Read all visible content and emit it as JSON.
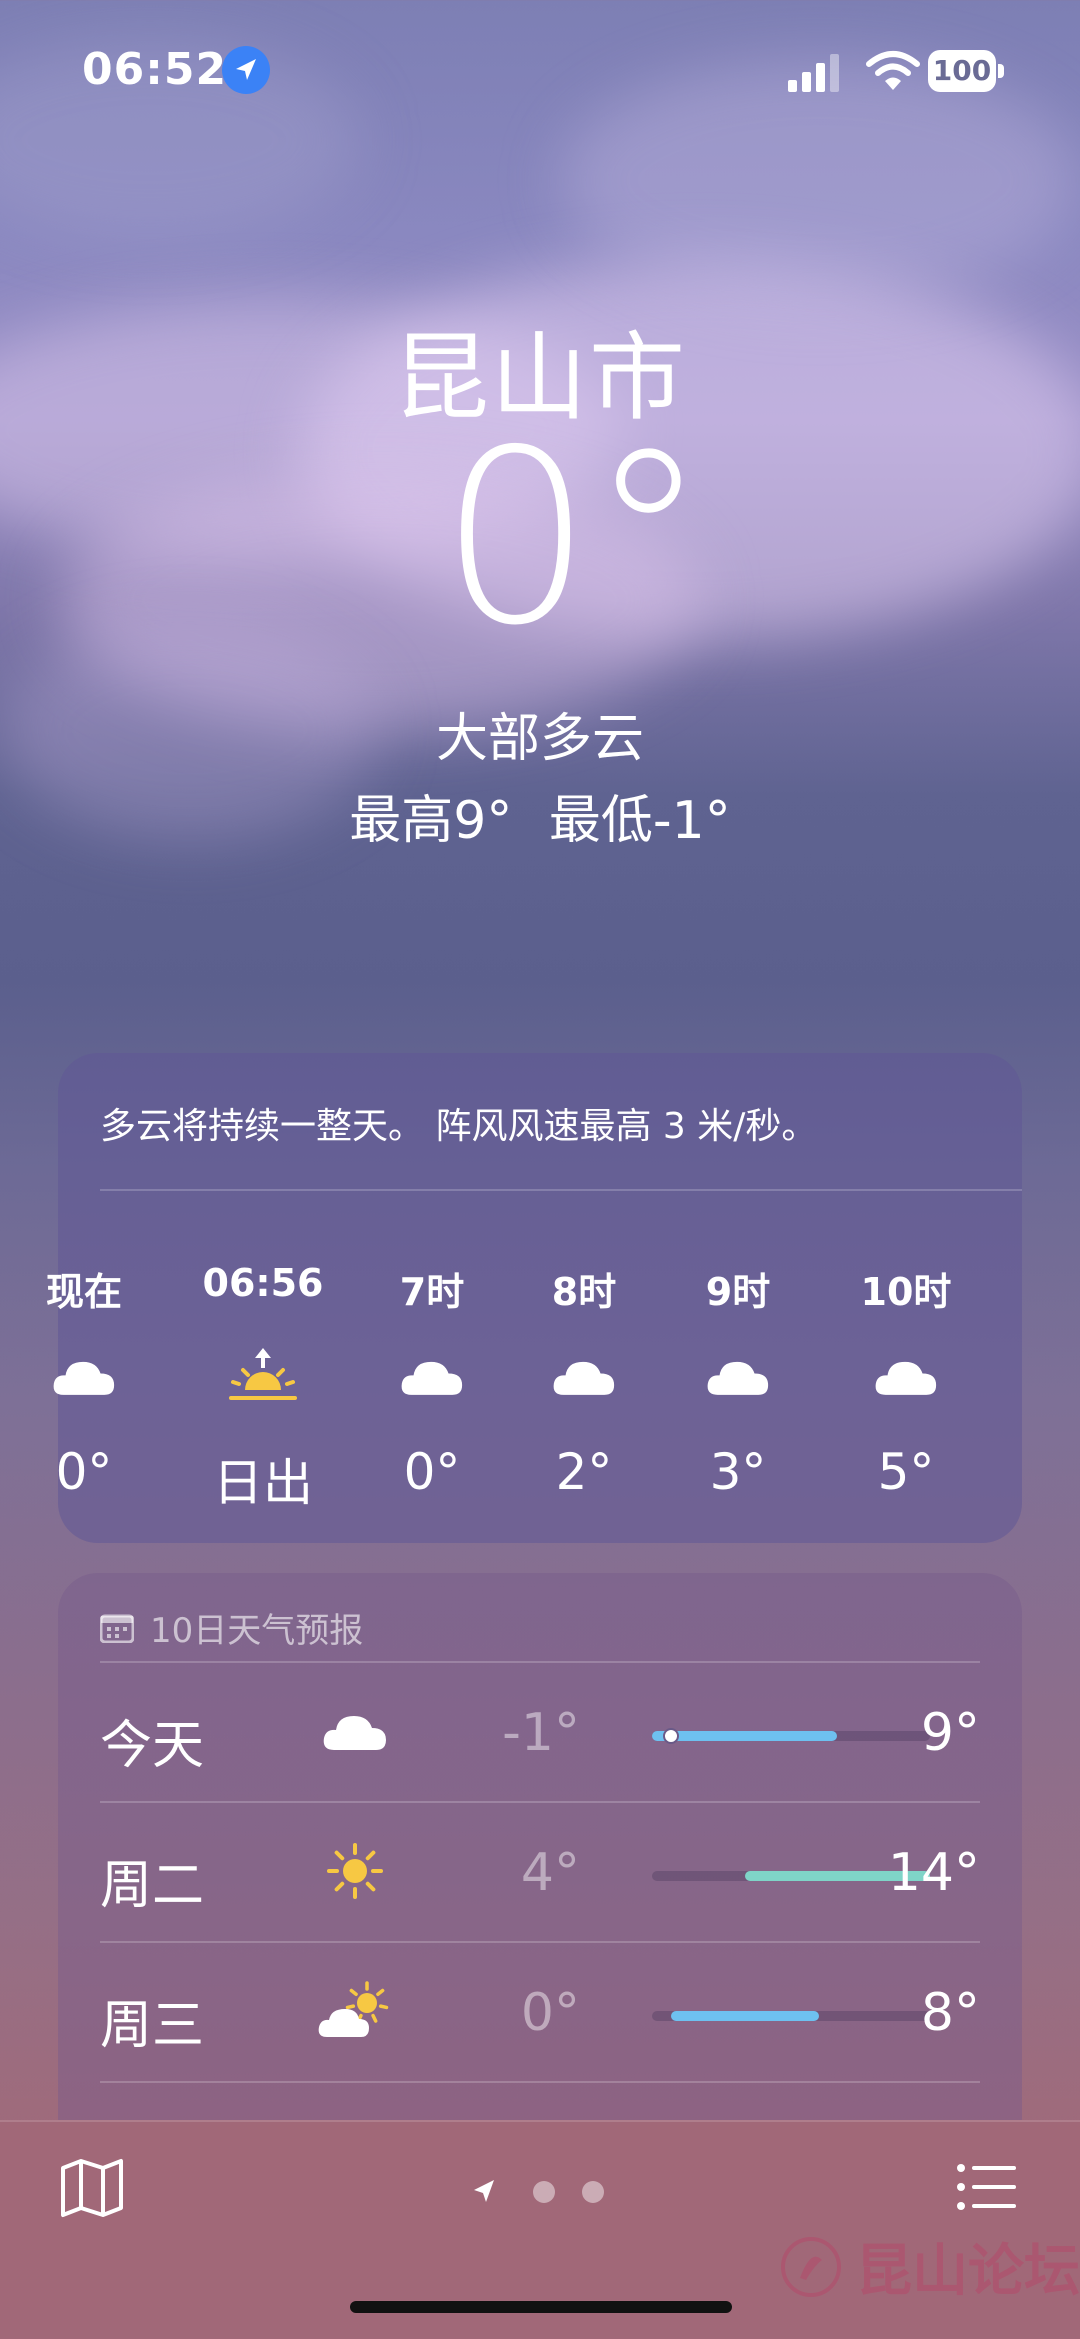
{
  "status": {
    "time": "06:52",
    "battery": "100"
  },
  "header": {
    "city": "昆山市",
    "temp": "0°",
    "condition": "大部多云",
    "high": "最高9°",
    "low": "最低-1°"
  },
  "hourly": {
    "summary": "多云将持续一整天。 阵风风速最高 3 米/秒。",
    "items": [
      {
        "label": "现在",
        "icon": "cloud-icon",
        "value": "0°"
      },
      {
        "label": "06:56",
        "icon": "sunrise-icon",
        "value": "日出"
      },
      {
        "label": "7时",
        "icon": "cloud-icon",
        "value": "0°"
      },
      {
        "label": "8时",
        "icon": "cloud-icon",
        "value": "2°"
      },
      {
        "label": "9时",
        "icon": "cloud-icon",
        "value": "3°"
      },
      {
        "label": "10时",
        "icon": "cloud-icon",
        "value": "5°"
      }
    ]
  },
  "daily": {
    "title": "10日天气预报",
    "range": {
      "min": -1,
      "max": 14
    },
    "days": [
      {
        "day": "今天",
        "icon": "cloud-icon",
        "low": "-1°",
        "high": "9°",
        "low_val": -1,
        "high_val": 9,
        "current": 0,
        "color": "#6ec1f0"
      },
      {
        "day": "周二",
        "icon": "sun-icon",
        "low": "4°",
        "high": "14°",
        "low_val": 4,
        "high_val": 14,
        "color": "#7fd4c8"
      },
      {
        "day": "周三",
        "icon": "partly-sunny-icon",
        "low": "0°",
        "high": "8°",
        "low_val": 0,
        "high_val": 8,
        "color": "#6ec1f0"
      }
    ]
  },
  "footer": {
    "watermark": "昆山论坛"
  }
}
